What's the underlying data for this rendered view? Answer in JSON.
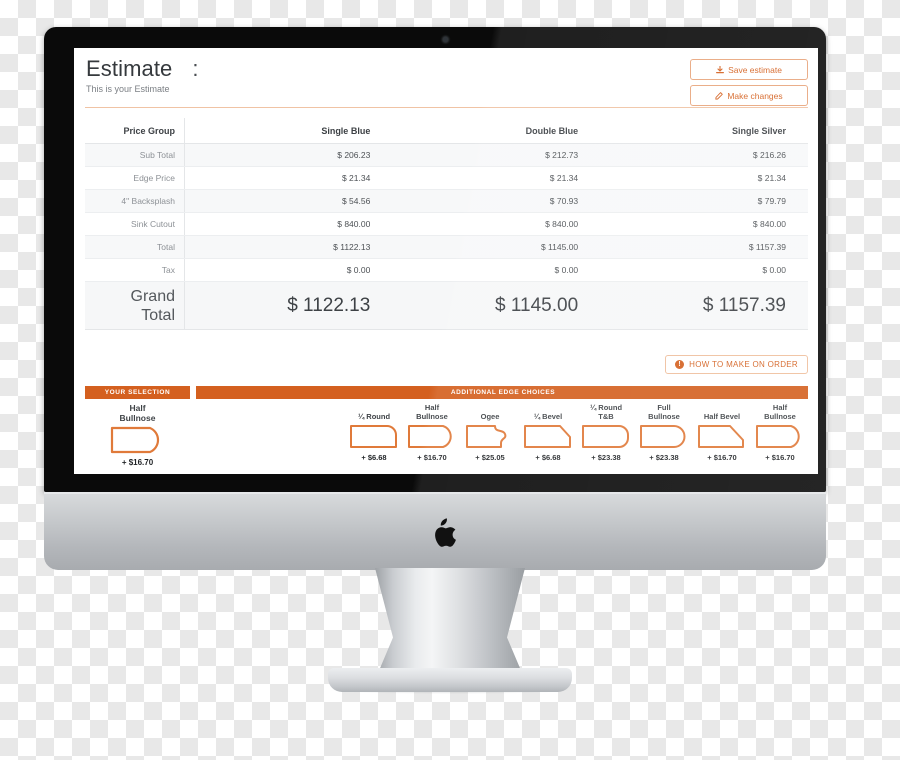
{
  "device": {
    "brand_logo": "apple-logo"
  },
  "header": {
    "title": "Estimate",
    "title_colon": ":",
    "subtitle": "This is your Estimate",
    "buttons": [
      {
        "label": "Save estimate",
        "icon": "download-icon"
      },
      {
        "label": "Make changes",
        "icon": "edit-pencil-icon"
      }
    ]
  },
  "table": {
    "columns": [
      "Price Group",
      "Single Blue",
      "Double Blue",
      "Single Silver"
    ],
    "rows": [
      {
        "label": "Sub Total",
        "values": [
          "$ 206.23",
          "$ 212.73",
          "$ 216.26"
        ]
      },
      {
        "label": "Edge Price",
        "values": [
          "$ 21.34",
          "$ 21.34",
          "$ 21.34"
        ]
      },
      {
        "label": "4\" Backsplash",
        "values": [
          "$ 54.56",
          "$ 70.93",
          "$ 79.79"
        ]
      },
      {
        "label": "Sink Cutout",
        "values": [
          "$ 840.00",
          "$ 840.00",
          "$ 840.00"
        ]
      },
      {
        "label": "Total",
        "values": [
          "$ 1122.13",
          "$ 1145.00",
          "$ 1157.39"
        ]
      },
      {
        "label": "Tax",
        "values": [
          "$ 0.00",
          "$ 0.00",
          "$ 0.00"
        ]
      }
    ],
    "grand_total": {
      "label_line1": "Grand",
      "label_line2": "Total",
      "values": [
        "$ 1122.13",
        "$ 1145.00",
        "$ 1157.39"
      ]
    }
  },
  "howto": {
    "label": "HOW TO MAKE ON ORDER",
    "icon": "info-circle-icon"
  },
  "edges": {
    "selection_bar": "YOUR SELECTION",
    "additional_bar": "ADDITIONAL EDGE CHOICES",
    "selected": [
      {
        "name_line1": "Half",
        "name_line2": "Bullnose",
        "price": "+ $16.70",
        "shape": "half-bullnose"
      }
    ],
    "choices": [
      {
        "name_line1": "",
        "name_line2": "¼ Round",
        "price": "+ $6.68",
        "shape": "quarter-round"
      },
      {
        "name_line1": "Half",
        "name_line2": "Bullnose",
        "price": "+ $16.70",
        "shape": "half-bullnose"
      },
      {
        "name_line1": "",
        "name_line2": "Ogee",
        "price": "+ $25.05",
        "shape": "ogee"
      },
      {
        "name_line1": "",
        "name_line2": "¼ Bevel",
        "price": "+ $6.68",
        "shape": "quarter-bevel"
      },
      {
        "name_line1": "¼ Round",
        "name_line2": "T&B",
        "price": "+ $23.38",
        "shape": "quarter-round-tb"
      },
      {
        "name_line1": "Full",
        "name_line2": "Bullnose",
        "price": "+ $23.38",
        "shape": "full-bullnose"
      },
      {
        "name_line1": "",
        "name_line2": "Half Bevel",
        "price": "+ $16.70",
        "shape": "half-bevel"
      },
      {
        "name_line1": "Half",
        "name_line2": "Bullnose",
        "price": "+ $16.70",
        "shape": "half-bullnose"
      }
    ]
  },
  "colors": {
    "accent": "#d4601f",
    "accent_light": "#efbf9d",
    "text": "#3d4145",
    "muted": "#8d9196"
  }
}
